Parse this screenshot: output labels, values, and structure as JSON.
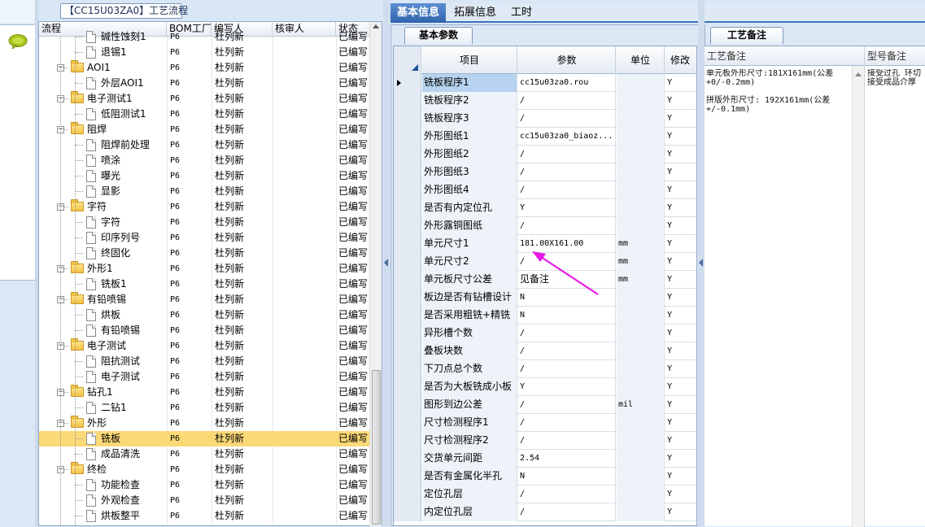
{
  "left_tab_label": "【CC15U03ZA0】工艺流程",
  "tree": {
    "headers": [
      "流程",
      "BOM工厂",
      "编写人",
      "核审人",
      "状态"
    ],
    "rows": [
      {
        "label": "碱性蚀刻1",
        "level": 2,
        "kind": "doc",
        "bom": "P6",
        "writer": "杜列新",
        "reviewer": "",
        "status": "已编写"
      },
      {
        "label": "退锡1",
        "level": 2,
        "kind": "doc",
        "bom": "P6",
        "writer": "杜列新",
        "reviewer": "",
        "status": "已编写"
      },
      {
        "label": "AOI1",
        "level": 1,
        "kind": "folder",
        "bom": "P6",
        "writer": "杜列新",
        "reviewer": "",
        "status": "已编写"
      },
      {
        "label": "外层AOI1",
        "level": 2,
        "kind": "doc",
        "bom": "P6",
        "writer": "杜列新",
        "reviewer": "",
        "status": "已编写"
      },
      {
        "label": "电子测试1",
        "level": 1,
        "kind": "folder",
        "bom": "P6",
        "writer": "杜列新",
        "reviewer": "",
        "status": "已编写"
      },
      {
        "label": "低阻测试1",
        "level": 2,
        "kind": "doc",
        "bom": "P6",
        "writer": "杜列新",
        "reviewer": "",
        "status": "已编写"
      },
      {
        "label": "阻焊",
        "level": 1,
        "kind": "folder",
        "bom": "P6",
        "writer": "杜列新",
        "reviewer": "",
        "status": "已编写"
      },
      {
        "label": "阻焊前处理",
        "level": 2,
        "kind": "doc",
        "bom": "P6",
        "writer": "杜列新",
        "reviewer": "",
        "status": "已编写"
      },
      {
        "label": "喷涂",
        "level": 2,
        "kind": "doc",
        "bom": "P6",
        "writer": "杜列新",
        "reviewer": "",
        "status": "已编写"
      },
      {
        "label": "曝光",
        "level": 2,
        "kind": "doc",
        "bom": "P6",
        "writer": "杜列新",
        "reviewer": "",
        "status": "已编写"
      },
      {
        "label": "显影",
        "level": 2,
        "kind": "doc",
        "bom": "P6",
        "writer": "杜列新",
        "reviewer": "",
        "status": "已编写"
      },
      {
        "label": "字符",
        "level": 1,
        "kind": "folder",
        "bom": "P6",
        "writer": "杜列新",
        "reviewer": "",
        "status": "已编写"
      },
      {
        "label": "字符",
        "level": 2,
        "kind": "doc",
        "bom": "P6",
        "writer": "杜列新",
        "reviewer": "",
        "status": "已编写"
      },
      {
        "label": "印序列号",
        "level": 2,
        "kind": "doc",
        "bom": "P6",
        "writer": "杜列新",
        "reviewer": "",
        "status": "已编写"
      },
      {
        "label": "终固化",
        "level": 2,
        "kind": "doc",
        "bom": "P6",
        "writer": "杜列新",
        "reviewer": "",
        "status": "已编写"
      },
      {
        "label": "外形1",
        "level": 1,
        "kind": "folder",
        "bom": "P6",
        "writer": "杜列新",
        "reviewer": "",
        "status": "已编写"
      },
      {
        "label": "铣板1",
        "level": 2,
        "kind": "doc",
        "bom": "P6",
        "writer": "杜列新",
        "reviewer": "",
        "status": "已编写"
      },
      {
        "label": "有铅喷锡",
        "level": 1,
        "kind": "folder",
        "bom": "P6",
        "writer": "杜列新",
        "reviewer": "",
        "status": "已编写"
      },
      {
        "label": "烘板",
        "level": 2,
        "kind": "doc",
        "bom": "P6",
        "writer": "杜列新",
        "reviewer": "",
        "status": "已编写"
      },
      {
        "label": "有铅喷锡",
        "level": 2,
        "kind": "doc",
        "bom": "P6",
        "writer": "杜列新",
        "reviewer": "",
        "status": "已编写"
      },
      {
        "label": "电子测试",
        "level": 1,
        "kind": "folder",
        "bom": "P6",
        "writer": "杜列新",
        "reviewer": "",
        "status": "已编写"
      },
      {
        "label": "阻抗测试",
        "level": 2,
        "kind": "doc",
        "bom": "P6",
        "writer": "杜列新",
        "reviewer": "",
        "status": "已编写"
      },
      {
        "label": "电子测试",
        "level": 2,
        "kind": "doc",
        "bom": "P6",
        "writer": "杜列新",
        "reviewer": "",
        "status": "已编写"
      },
      {
        "label": "钻孔1",
        "level": 1,
        "kind": "folder",
        "bom": "P6",
        "writer": "杜列新",
        "reviewer": "",
        "status": "已编写"
      },
      {
        "label": "二钻1",
        "level": 2,
        "kind": "doc",
        "bom": "P6",
        "writer": "杜列新",
        "reviewer": "",
        "status": "已编写"
      },
      {
        "label": "外形",
        "level": 1,
        "kind": "folder",
        "bom": "P6",
        "writer": "杜列新",
        "reviewer": "",
        "status": "已编写"
      },
      {
        "label": "铣板",
        "level": 2,
        "kind": "doc",
        "bom": "P6",
        "writer": "杜列新",
        "reviewer": "",
        "status": "已编写",
        "selected": true
      },
      {
        "label": "成品清洗",
        "level": 2,
        "kind": "doc",
        "bom": "P6",
        "writer": "杜列新",
        "reviewer": "",
        "status": "已编写"
      },
      {
        "label": "终检",
        "level": 1,
        "kind": "folder",
        "bom": "P6",
        "writer": "杜列新",
        "reviewer": "",
        "status": "已编写"
      },
      {
        "label": "功能检查",
        "level": 2,
        "kind": "doc",
        "bom": "P6",
        "writer": "杜列新",
        "reviewer": "",
        "status": "已编写"
      },
      {
        "label": "外观检查",
        "level": 2,
        "kind": "doc",
        "bom": "P6",
        "writer": "杜列新",
        "reviewer": "",
        "status": "已编写"
      },
      {
        "label": "烘板整平",
        "level": 2,
        "kind": "doc",
        "bom": "P6",
        "writer": "杜列新",
        "reviewer": "",
        "status": "已编写"
      }
    ]
  },
  "top_tabs": [
    "基本信息",
    "拓展信息",
    "工时"
  ],
  "mid_subtab": "基本参数",
  "params": {
    "headers": [
      "项目",
      "参数",
      "单位",
      "修改"
    ],
    "rows": [
      {
        "name": "铣板程序1",
        "value": "cc15u03za0.rou",
        "unit": "",
        "mod": "Y",
        "current": true
      },
      {
        "name": "铣板程序2",
        "value": "/",
        "unit": "",
        "mod": "Y"
      },
      {
        "name": "铣板程序3",
        "value": "/",
        "unit": "",
        "mod": "Y"
      },
      {
        "name": "外形图纸1",
        "value": "cc15u03za0_biaoz...",
        "unit": "",
        "mod": "Y"
      },
      {
        "name": "外形图纸2",
        "value": "/",
        "unit": "",
        "mod": "Y"
      },
      {
        "name": "外形图纸3",
        "value": "/",
        "unit": "",
        "mod": "Y"
      },
      {
        "name": "外形图纸4",
        "value": "/",
        "unit": "",
        "mod": "Y"
      },
      {
        "name": "是否有内定位孔",
        "value": "Y",
        "unit": "",
        "mod": "Y"
      },
      {
        "name": "外形露铜图纸",
        "value": "/",
        "unit": "",
        "mod": "Y"
      },
      {
        "name": "单元尺寸1",
        "value": "181.00X161.00",
        "unit": "mm",
        "mod": "Y"
      },
      {
        "name": "单元尺寸2",
        "value": "/",
        "unit": "mm",
        "mod": "Y"
      },
      {
        "name": "单元板尺寸公差",
        "value": "见备注",
        "unit": "mm",
        "mod": "Y"
      },
      {
        "name": "板边是否有钻槽设计",
        "value": "N",
        "unit": "",
        "mod": "Y"
      },
      {
        "name": "是否采用粗铣+精铣",
        "value": "N",
        "unit": "",
        "mod": "Y"
      },
      {
        "name": "异形槽个数",
        "value": "/",
        "unit": "",
        "mod": "Y"
      },
      {
        "name": "叠板块数",
        "value": "/",
        "unit": "",
        "mod": "Y"
      },
      {
        "name": "下刀点总个数",
        "value": "/",
        "unit": "",
        "mod": "Y"
      },
      {
        "name": "是否为大板铣成小板",
        "value": "Y",
        "unit": "",
        "mod": "Y"
      },
      {
        "name": "图形到边公差",
        "value": "/",
        "unit": "mil",
        "mod": "Y"
      },
      {
        "name": "尺寸检测程序1",
        "value": "/",
        "unit": "",
        "mod": "Y"
      },
      {
        "name": "尺寸检测程序2",
        "value": "/",
        "unit": "",
        "mod": "Y"
      },
      {
        "name": "交货单元间距",
        "value": "2.54",
        "unit": "",
        "mod": "Y"
      },
      {
        "name": "是否有金属化半孔",
        "value": "N",
        "unit": "",
        "mod": "Y"
      },
      {
        "name": "定位孔层",
        "value": "/",
        "unit": "",
        "mod": "Y"
      },
      {
        "name": "内定位孔层",
        "value": "/",
        "unit": "",
        "mod": "Y"
      }
    ]
  },
  "right_subtab": "工艺备注",
  "notes": {
    "headers": [
      "工艺备注",
      "型号备注"
    ],
    "process_note_lines": [
      "单元板外形尺寸:181X161mm(公差",
      "+0/-0.2mm)",
      "",
      "拼版外形尺寸: 192X161mm(公差",
      "+/-0.1mm)"
    ],
    "model_note_lines": [
      "接受过孔 环切",
      "接受成品介厚"
    ]
  },
  "colors": {
    "selected_row": "#fbd977",
    "annotation_arrow": "#e619e6",
    "active_tab": "#2f63ae"
  },
  "icons": [
    "chat-bubble-icon",
    "folder-icon",
    "document-icon",
    "collapse-minus-icon",
    "row-pointer-icon",
    "annotation-arrow-icon"
  ]
}
